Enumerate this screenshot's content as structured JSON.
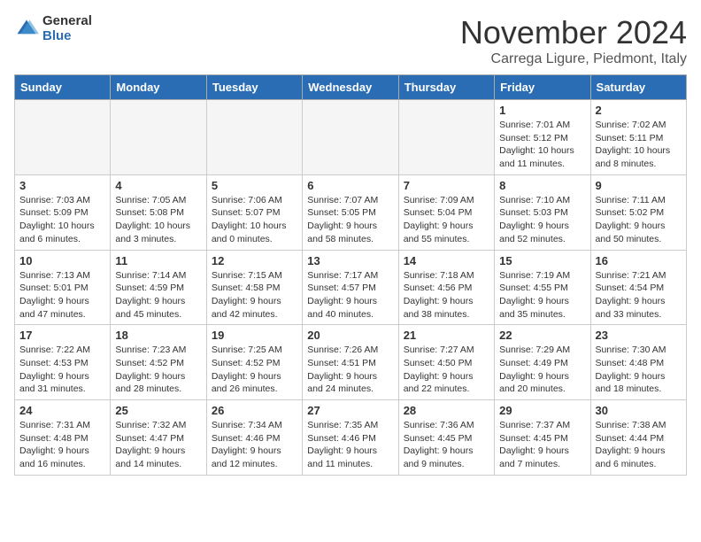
{
  "header": {
    "logo_general": "General",
    "logo_blue": "Blue",
    "month_title": "November 2024",
    "location": "Carrega Ligure, Piedmont, Italy"
  },
  "weekdays": [
    "Sunday",
    "Monday",
    "Tuesday",
    "Wednesday",
    "Thursday",
    "Friday",
    "Saturday"
  ],
  "weeks": [
    [
      {
        "day": "",
        "info": ""
      },
      {
        "day": "",
        "info": ""
      },
      {
        "day": "",
        "info": ""
      },
      {
        "day": "",
        "info": ""
      },
      {
        "day": "",
        "info": ""
      },
      {
        "day": "1",
        "info": "Sunrise: 7:01 AM\nSunset: 5:12 PM\nDaylight: 10 hours and 11 minutes."
      },
      {
        "day": "2",
        "info": "Sunrise: 7:02 AM\nSunset: 5:11 PM\nDaylight: 10 hours and 8 minutes."
      }
    ],
    [
      {
        "day": "3",
        "info": "Sunrise: 7:03 AM\nSunset: 5:09 PM\nDaylight: 10 hours and 6 minutes."
      },
      {
        "day": "4",
        "info": "Sunrise: 7:05 AM\nSunset: 5:08 PM\nDaylight: 10 hours and 3 minutes."
      },
      {
        "day": "5",
        "info": "Sunrise: 7:06 AM\nSunset: 5:07 PM\nDaylight: 10 hours and 0 minutes."
      },
      {
        "day": "6",
        "info": "Sunrise: 7:07 AM\nSunset: 5:05 PM\nDaylight: 9 hours and 58 minutes."
      },
      {
        "day": "7",
        "info": "Sunrise: 7:09 AM\nSunset: 5:04 PM\nDaylight: 9 hours and 55 minutes."
      },
      {
        "day": "8",
        "info": "Sunrise: 7:10 AM\nSunset: 5:03 PM\nDaylight: 9 hours and 52 minutes."
      },
      {
        "day": "9",
        "info": "Sunrise: 7:11 AM\nSunset: 5:02 PM\nDaylight: 9 hours and 50 minutes."
      }
    ],
    [
      {
        "day": "10",
        "info": "Sunrise: 7:13 AM\nSunset: 5:01 PM\nDaylight: 9 hours and 47 minutes."
      },
      {
        "day": "11",
        "info": "Sunrise: 7:14 AM\nSunset: 4:59 PM\nDaylight: 9 hours and 45 minutes."
      },
      {
        "day": "12",
        "info": "Sunrise: 7:15 AM\nSunset: 4:58 PM\nDaylight: 9 hours and 42 minutes."
      },
      {
        "day": "13",
        "info": "Sunrise: 7:17 AM\nSunset: 4:57 PM\nDaylight: 9 hours and 40 minutes."
      },
      {
        "day": "14",
        "info": "Sunrise: 7:18 AM\nSunset: 4:56 PM\nDaylight: 9 hours and 38 minutes."
      },
      {
        "day": "15",
        "info": "Sunrise: 7:19 AM\nSunset: 4:55 PM\nDaylight: 9 hours and 35 minutes."
      },
      {
        "day": "16",
        "info": "Sunrise: 7:21 AM\nSunset: 4:54 PM\nDaylight: 9 hours and 33 minutes."
      }
    ],
    [
      {
        "day": "17",
        "info": "Sunrise: 7:22 AM\nSunset: 4:53 PM\nDaylight: 9 hours and 31 minutes."
      },
      {
        "day": "18",
        "info": "Sunrise: 7:23 AM\nSunset: 4:52 PM\nDaylight: 9 hours and 28 minutes."
      },
      {
        "day": "19",
        "info": "Sunrise: 7:25 AM\nSunset: 4:52 PM\nDaylight: 9 hours and 26 minutes."
      },
      {
        "day": "20",
        "info": "Sunrise: 7:26 AM\nSunset: 4:51 PM\nDaylight: 9 hours and 24 minutes."
      },
      {
        "day": "21",
        "info": "Sunrise: 7:27 AM\nSunset: 4:50 PM\nDaylight: 9 hours and 22 minutes."
      },
      {
        "day": "22",
        "info": "Sunrise: 7:29 AM\nSunset: 4:49 PM\nDaylight: 9 hours and 20 minutes."
      },
      {
        "day": "23",
        "info": "Sunrise: 7:30 AM\nSunset: 4:48 PM\nDaylight: 9 hours and 18 minutes."
      }
    ],
    [
      {
        "day": "24",
        "info": "Sunrise: 7:31 AM\nSunset: 4:48 PM\nDaylight: 9 hours and 16 minutes."
      },
      {
        "day": "25",
        "info": "Sunrise: 7:32 AM\nSunset: 4:47 PM\nDaylight: 9 hours and 14 minutes."
      },
      {
        "day": "26",
        "info": "Sunrise: 7:34 AM\nSunset: 4:46 PM\nDaylight: 9 hours and 12 minutes."
      },
      {
        "day": "27",
        "info": "Sunrise: 7:35 AM\nSunset: 4:46 PM\nDaylight: 9 hours and 11 minutes."
      },
      {
        "day": "28",
        "info": "Sunrise: 7:36 AM\nSunset: 4:45 PM\nDaylight: 9 hours and 9 minutes."
      },
      {
        "day": "29",
        "info": "Sunrise: 7:37 AM\nSunset: 4:45 PM\nDaylight: 9 hours and 7 minutes."
      },
      {
        "day": "30",
        "info": "Sunrise: 7:38 AM\nSunset: 4:44 PM\nDaylight: 9 hours and 6 minutes."
      }
    ]
  ]
}
